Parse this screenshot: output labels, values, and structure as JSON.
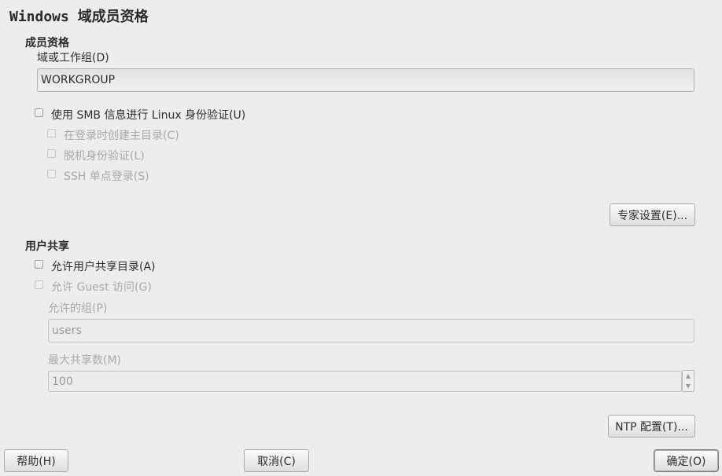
{
  "window": {
    "title": "Windows 域成员资格"
  },
  "membership": {
    "heading": "成员资格",
    "domain_label": "域或工作组(D)",
    "domain_value": "WORKGROUP",
    "use_smb_auth": "使用 SMB 信息进行 Linux 身份验证(U)",
    "create_home_dir": "在登录时创建主目录(C)",
    "offline_auth": "脱机身份验证(L)",
    "ssh_sso": "SSH 单点登录(S)",
    "expert_button": "专家设置(E)..."
  },
  "sharing": {
    "heading": "用户共享",
    "allow_user_shares": "允许用户共享目录(A)",
    "allow_guest": "允许 Guest 访问(G)",
    "allowed_group_label": "允许的组(P)",
    "allowed_group_value": "users",
    "max_shares_label": "最大共享数(M)",
    "max_shares_value": "100",
    "ntp_button": "NTP 配置(T)..."
  },
  "footer": {
    "help_button": "帮助(H)",
    "cancel_button": "取消(C)",
    "ok_button": "确定(O)"
  },
  "icons": {
    "spin_up": "▲",
    "spin_down": "▼"
  }
}
